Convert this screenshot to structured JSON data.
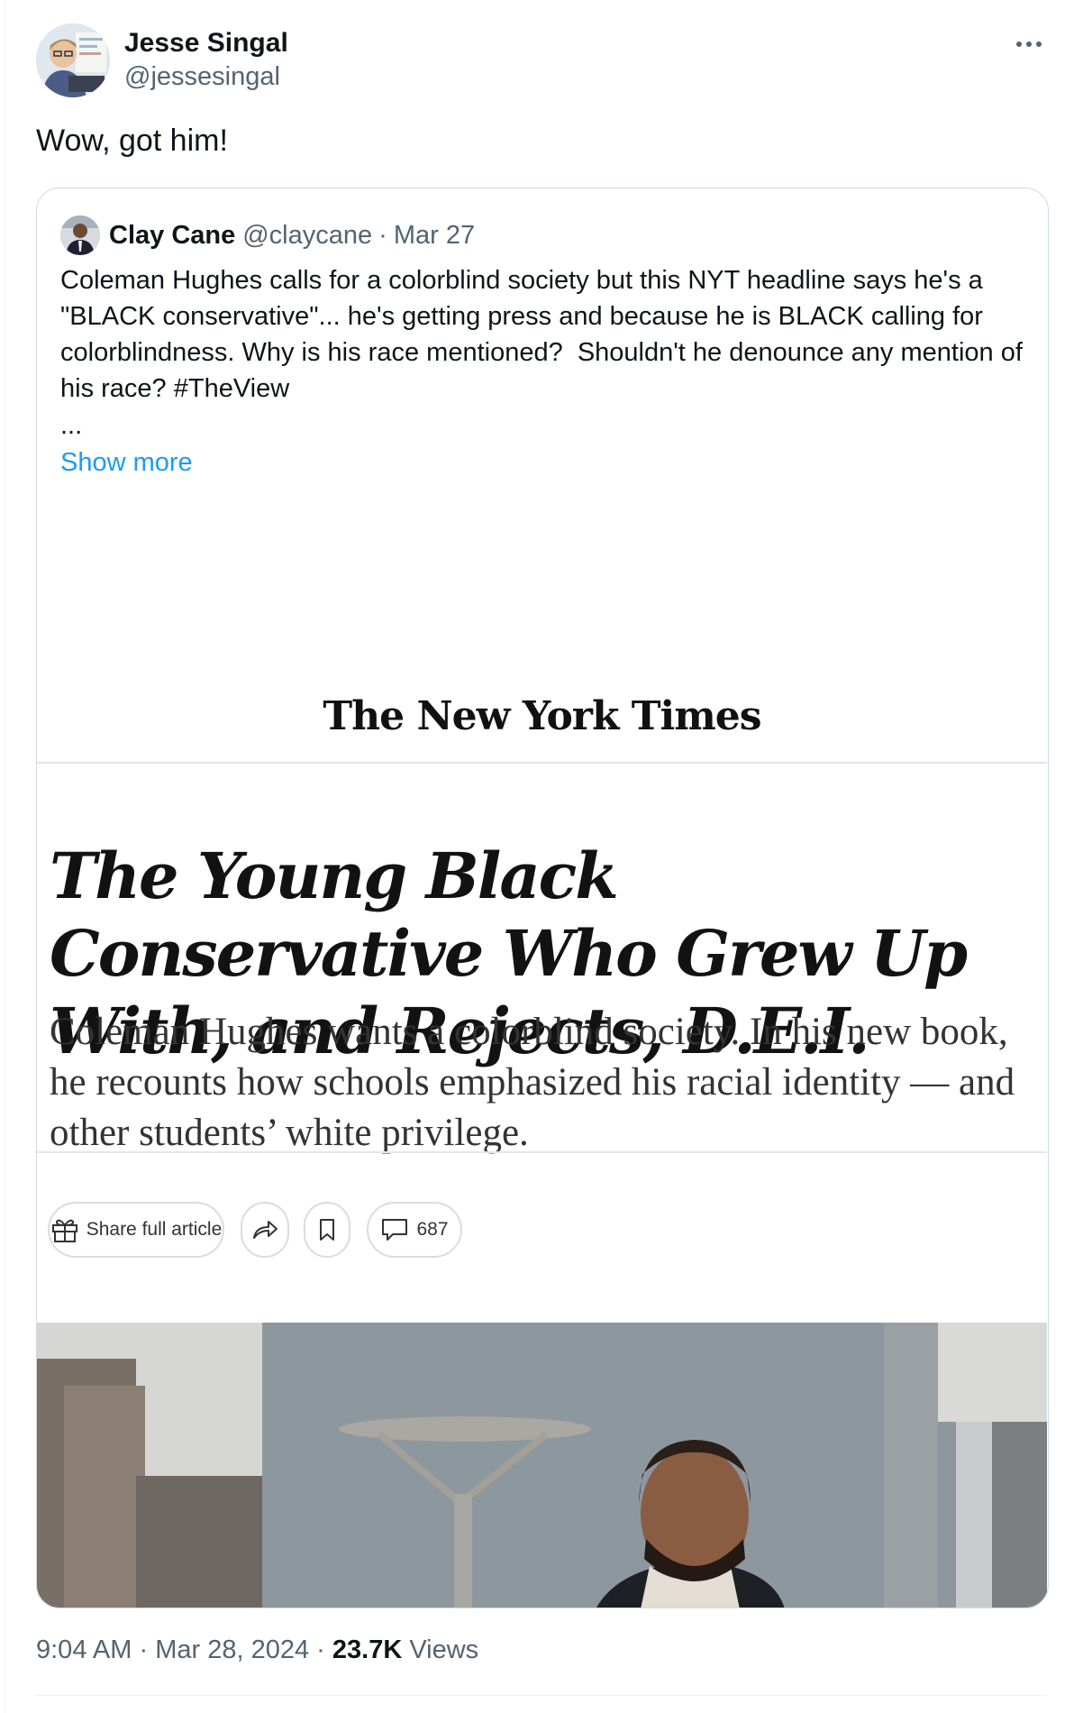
{
  "tweet": {
    "author": {
      "display_name": "Jesse Singal",
      "handle": "@jessesingal"
    },
    "text": "Wow, got him!",
    "time": "9:04 AM",
    "date": "Mar 28, 2024",
    "views_count": "23.7K",
    "views_label": "Views",
    "separator": "·"
  },
  "quote": {
    "author": {
      "display_name": "Clay Cane",
      "handle": "@claycane"
    },
    "separator": "·",
    "date": "Mar 27",
    "text": "Coleman Hughes calls for a colorblind society but this NYT headline says he's a \"BLACK conservative\"... he's getting press and because he is BLACK calling for colorblindness. Why is his race mentioned?  Shouldn't he denounce any mention of his race? #TheView",
    "ellipsis": "...",
    "show_more": "Show more"
  },
  "article_image": {
    "publication": "The New York Times",
    "headline": "The Young Black Conservative Who Grew Up With, and Rejects, D.E.I.",
    "deck": "Coleman Hughes wants a colorblind society. In his new book, he recounts how schools emphasized his racial identity — and other students’ white privilege.",
    "share_label": "Share full article",
    "comments_count": "687"
  },
  "colors": {
    "accent": "#1d9bf0",
    "text": "#0f1419",
    "muted": "#536471",
    "border": "#cfd9de"
  },
  "icons": [
    "more-icon",
    "gift-icon",
    "share-arrow-icon",
    "bookmark-icon",
    "comment-icon"
  ]
}
